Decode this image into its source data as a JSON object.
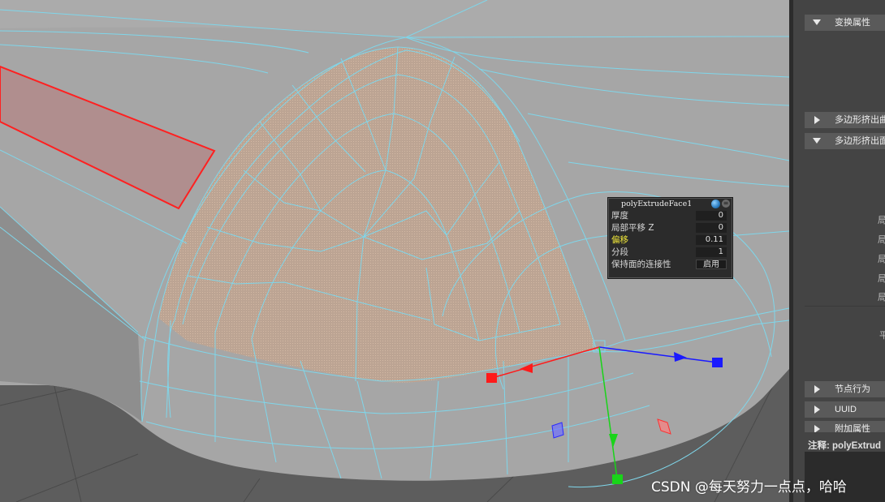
{
  "hud": {
    "title": "polyExtrudeFace1",
    "globe_icon": "globe-icon",
    "menu_icon": "menu-icon",
    "rows": [
      {
        "label": "厚度",
        "value": "0"
      },
      {
        "label": "局部平移 Z",
        "value": "0"
      },
      {
        "label": "偏移",
        "value": "0.11"
      },
      {
        "label": "分段",
        "value": "1"
      },
      {
        "label": "保持面的连接性",
        "value": "启用"
      }
    ]
  },
  "panel": {
    "sections": [
      {
        "label": "变换属性",
        "expanded": true
      },
      {
        "label": "多边形挤出曲",
        "expanded": false
      },
      {
        "label": "多边形挤出面",
        "expanded": true
      },
      {
        "label": "节点行为",
        "expanded": false
      },
      {
        "label": "UUID",
        "expanded": false
      },
      {
        "label": "附加属性",
        "expanded": false
      }
    ],
    "glyphs": [
      "局",
      "局",
      "局",
      "局",
      "局",
      "平"
    ],
    "notes_label": "注释:  polyExtrud"
  },
  "watermark": "CSDN @每天努力一点点，哈哈",
  "colors": {
    "wire": "#7fd6ea",
    "selected_face": "#bfa590",
    "red_edge": "#ff2020",
    "axis_x": "#ff1a1a",
    "axis_y": "#19d419",
    "axis_z": "#1a1aff"
  }
}
